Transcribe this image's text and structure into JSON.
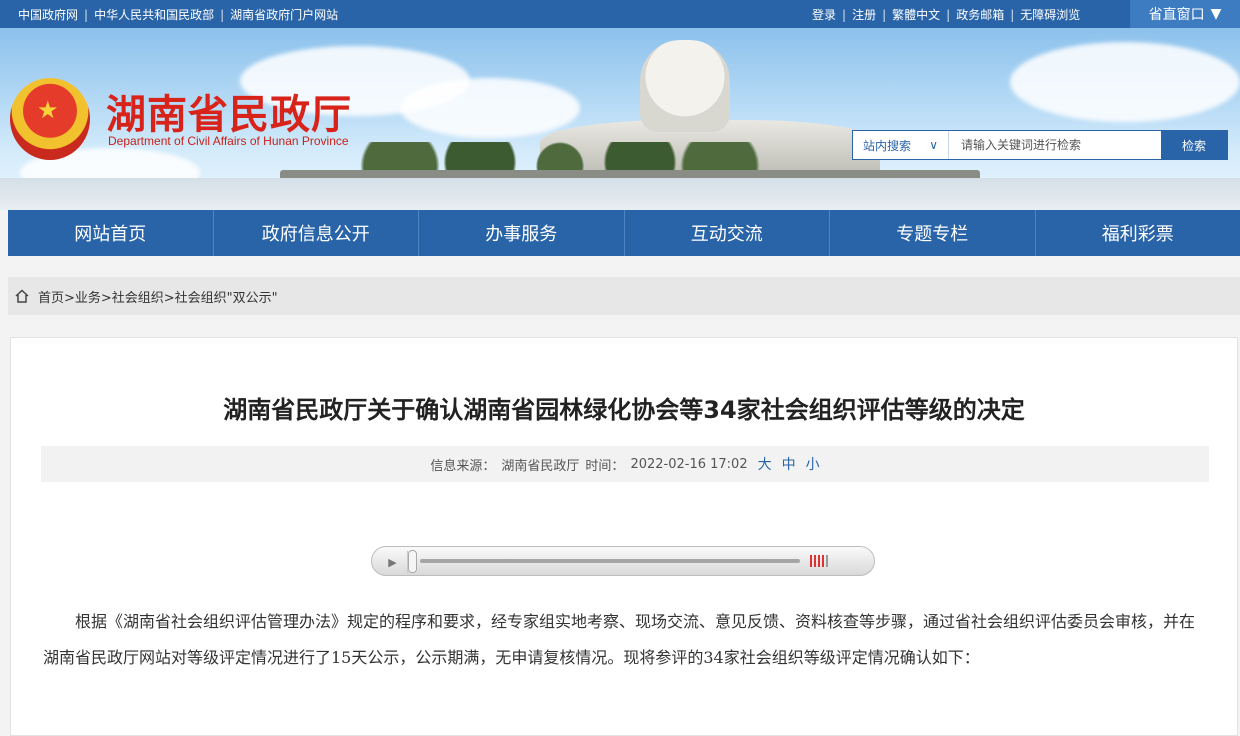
{
  "topbar": {
    "links": [
      "中国政府网",
      "中华人民共和国民政部",
      "湖南省政府门户网站"
    ],
    "right_links": [
      "登录",
      "注册",
      "繁體中文",
      "政务邮箱",
      "无障碍浏览"
    ],
    "portal_label": "省直窗口",
    "portal_icon": "caret-down-icon"
  },
  "header": {
    "site_title": "湖南省民政厅",
    "site_subtitle": "Department of Civil Affairs of Hunan Province"
  },
  "search": {
    "scope_label": "站内搜索",
    "scope_icon": "chevron-down-icon",
    "placeholder": "请输入关键词进行检索",
    "button_label": "检索"
  },
  "nav": {
    "items": [
      "网站首页",
      "政府信息公开",
      "办事服务",
      "互动交流",
      "专题专栏",
      "福利彩票"
    ]
  },
  "breadcrumb": {
    "path": "首页>业务>社会组织>社会组织\"双公示\""
  },
  "article": {
    "title": "湖南省民政厅关于确认湖南省园林绿化协会等34家社会组织评估等级的决定",
    "source_label": "信息来源：",
    "source": "湖南省民政厅",
    "time_label": "时间：",
    "time": "2022-02-16 17:02",
    "font_sizes": [
      "大",
      "中",
      "小"
    ],
    "body": "根据《湖南省社会组织评估管理办法》规定的程序和要求，经专家组实地考察、现场交流、意见反馈、资料核查等步骤，通过省社会组织评估委员会审核，并在湖南省民政厅网站对等级评定情况进行了15天公示，公示期满，无申请复核情况。现将参评的34家社会组织等级评定情况确认如下："
  },
  "audio_player": {
    "progress": 0.0,
    "play_icon": "play-icon"
  },
  "colors": {
    "primary": "#2a64a8",
    "title_red": "#d8231a"
  }
}
